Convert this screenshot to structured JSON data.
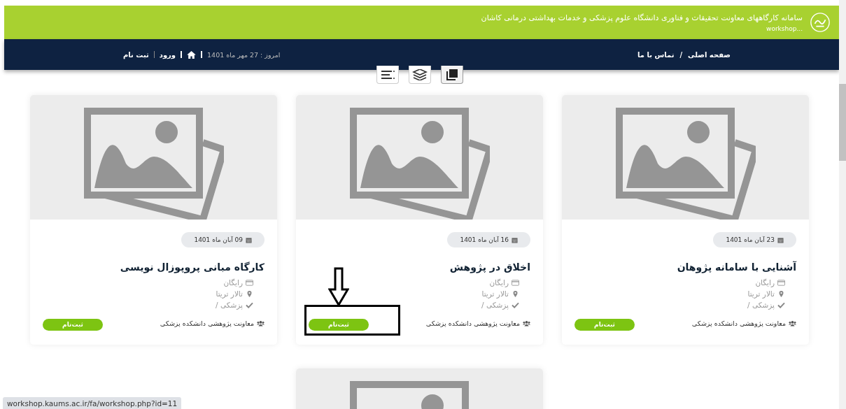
{
  "header": {
    "title": "سامانه کارگاههای معاونت تحقیقات و فناوری دانشگاه علوم پزشکی و خدمات بهداشتی درمانی کاشان",
    "subtitle": "workshop..."
  },
  "nav": {
    "links": [
      "صفحه اصلی",
      "تماس با ما"
    ],
    "separator": "/",
    "today": "امروز : 27 مهر ماه 1401",
    "account_links": [
      "ورود",
      "ثبت نام"
    ]
  },
  "view_options": [
    {
      "kind": "list",
      "selected": false
    },
    {
      "kind": "layers",
      "selected": false
    },
    {
      "kind": "cards",
      "selected": true
    }
  ],
  "cards": [
    {
      "date": "23 آبان ماه 1401",
      "title": "آشنایی با سامانه پژوهان",
      "price": "رایگان",
      "place": "تالار تریتا",
      "category": "پزشکی /",
      "organizer": "معاونت پژوهشی دانشکده پزشکی",
      "button": "ثبت‌نام",
      "highlighted": false
    },
    {
      "date": "16 آبان ماه 1401",
      "title": "اخلاق در پژوهش",
      "price": "رایگان",
      "place": "تالار تریتا",
      "category": "پزشکی /",
      "organizer": "معاونت پژوهشی دانشکده پزشکی",
      "button": "ثبت‌نام",
      "highlighted": true
    },
    {
      "date": "09 آبان ماه 1401",
      "title": "کارگاه مبانی پروپوزال نویسی",
      "price": "رایگان",
      "place": "تالار تریتا",
      "category": "پزشکی /",
      "organizer": "معاونت پژوهشی دانشکده پزشکی",
      "button": "ثبت‌نام",
      "highlighted": false
    }
  ],
  "status_url": "workshop.kaums.ac.ir/fa/workshop.php?id=11"
}
